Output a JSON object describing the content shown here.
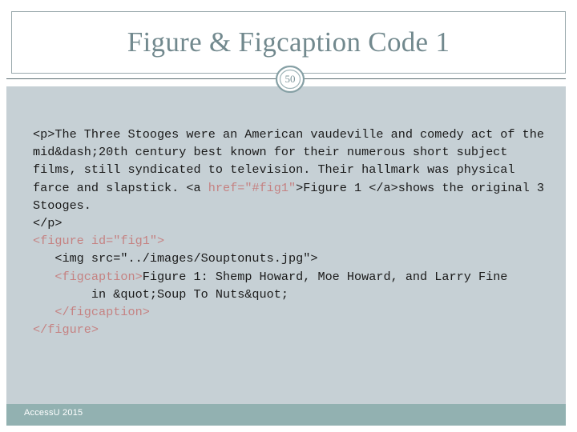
{
  "slide": {
    "title": "Figure & Figcaption Code 1",
    "page_number": "50",
    "footer": "AccessU 2015"
  },
  "colors": {
    "title": "#72898e",
    "body_background": "#c6d0d5",
    "footer_background": "#92b1b1",
    "footer_text": "#ffffff",
    "code_text": "#1a1a1a",
    "code_tag_highlight": "#c58282",
    "divider": "#5c6d72",
    "header_border": "#9aa9ad"
  },
  "code": {
    "segments": [
      {
        "text": "<p>The Three Stooges were an American vaudeville and comedy act of the mid&dash;20th century best known for their numerous short subject films, still syndicated to television. Their hallmark was physical farce and slapstick. <a ",
        "style": "plain"
      },
      {
        "text": "href=\"#fig1\"",
        "style": "tag"
      },
      {
        "text": ">Figure 1 </a>shows the original 3 Stooges.\n</p>\n",
        "style": "plain"
      },
      {
        "text": "<figure id=\"fig1\">",
        "style": "tag"
      },
      {
        "text": "\n   <img src=\"../images/Souptonuts.jpg\">\n   ",
        "style": "plain"
      },
      {
        "text": "<figcaption>",
        "style": "tag"
      },
      {
        "text": "Figure 1: Shemp Howard, Moe Howard, and Larry Fine\n        in &quot;Soup To Nuts&quot;\n   ",
        "style": "plain"
      },
      {
        "text": "</figcaption>",
        "style": "tag"
      },
      {
        "text": "\n",
        "style": "plain"
      },
      {
        "text": "</figure>",
        "style": "tag"
      }
    ]
  },
  "icons": {
    "page_badge": "circle-page-number-badge"
  }
}
